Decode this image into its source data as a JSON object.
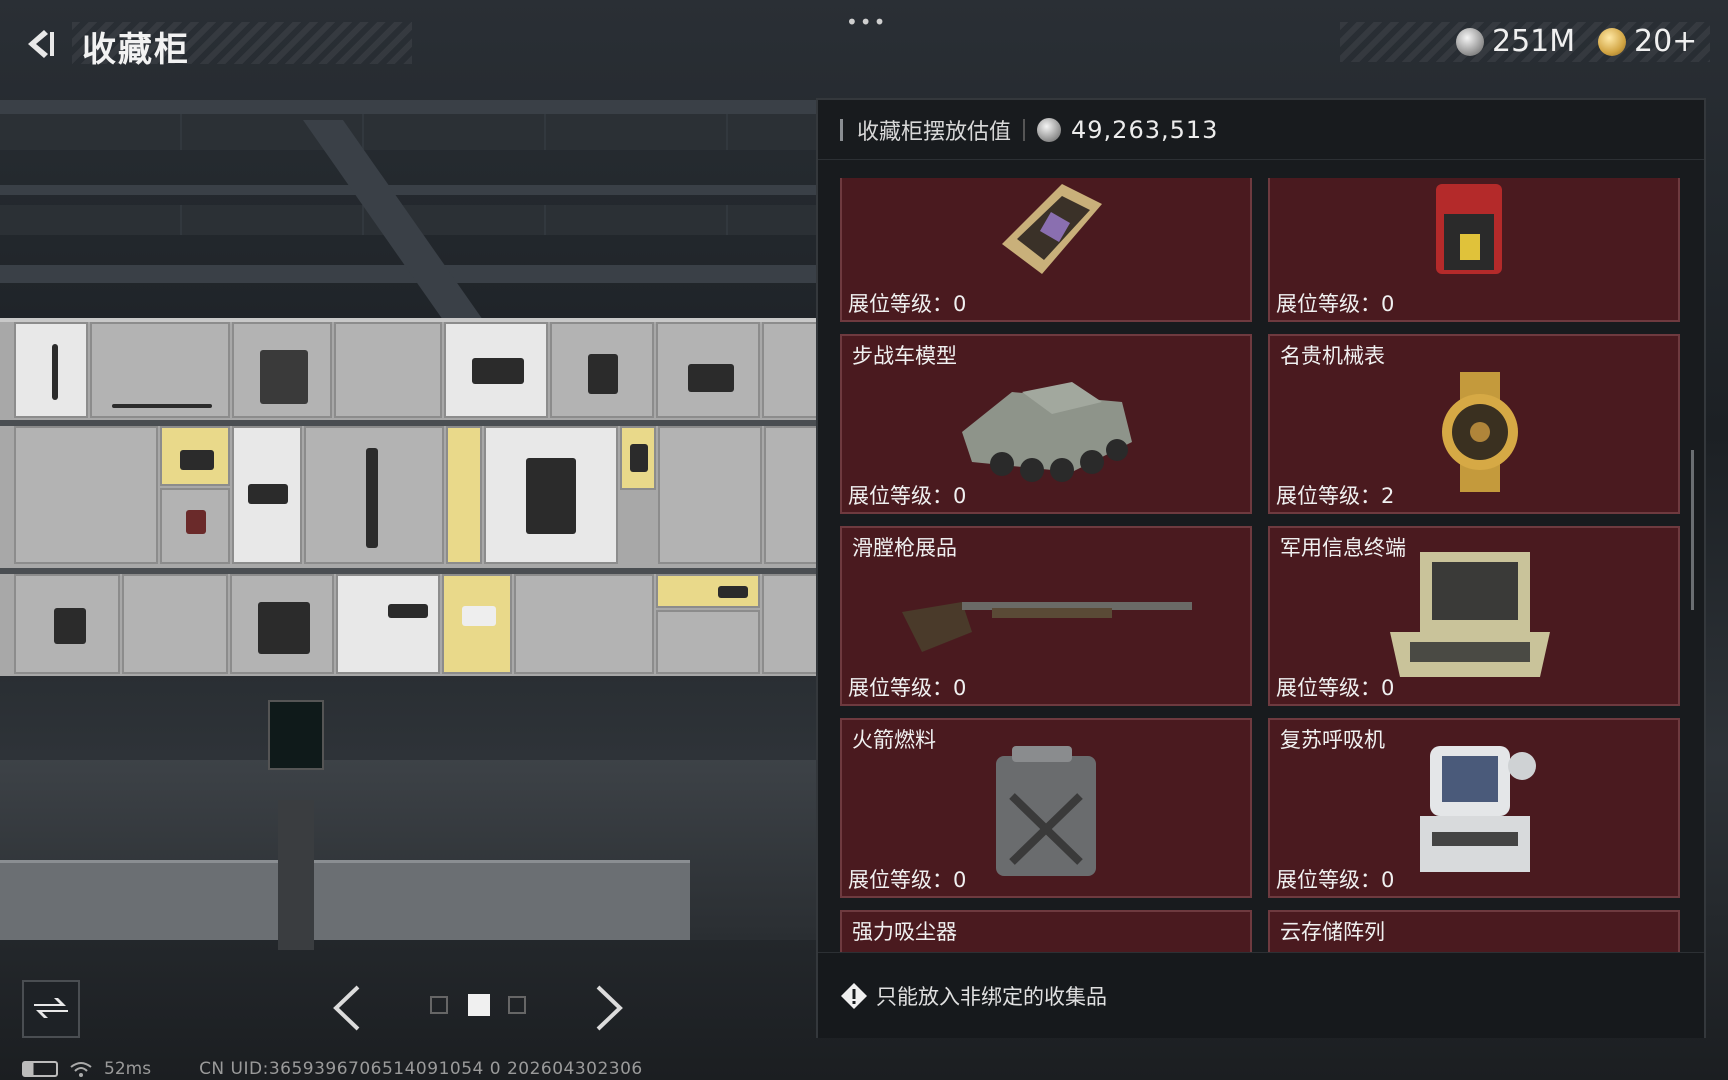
{
  "topbar": {
    "title": "收藏柜",
    "more": "•••",
    "currency_silver": "251M",
    "currency_gold": "20+"
  },
  "panel": {
    "header_label": "收藏柜摆放估值",
    "header_value": "49,263,513",
    "cards": [
      {
        "name": "",
        "level_label": "展位等级：",
        "level": "0",
        "art": "ram-chip-icon"
      },
      {
        "name": "",
        "level_label": "展位等级：",
        "level": "0",
        "art": "red-device-icon"
      },
      {
        "name": "步战车模型",
        "level_label": "展位等级：",
        "level": "0",
        "art": "ifv-model-icon"
      },
      {
        "name": "名贵机械表",
        "level_label": "展位等级：",
        "level": "2",
        "art": "gold-watch-icon"
      },
      {
        "name": "滑膛枪展品",
        "level_label": "展位等级：",
        "level": "0",
        "art": "musket-icon"
      },
      {
        "name": "军用信息终端",
        "level_label": "展位等级：",
        "level": "0",
        "art": "military-terminal-icon"
      },
      {
        "name": "火箭燃料",
        "level_label": "展位等级：",
        "level": "0",
        "art": "fuel-canister-icon"
      },
      {
        "name": "复苏呼吸机",
        "level_label": "展位等级：",
        "level": "0",
        "art": "ventilator-icon"
      },
      {
        "name": "强力吸尘器",
        "level_label": "",
        "level": "",
        "art": ""
      },
      {
        "name": "云存储阵列",
        "level_label": "",
        "level": "",
        "art": ""
      }
    ],
    "footer_text": "只能放入非绑定的收集品"
  },
  "pager": {
    "active_page": 2,
    "total_pages": 3
  },
  "status": {
    "ping": "52ms",
    "uid": "CN UID:3659396706514091054 0 202604302306"
  },
  "colors": {
    "card_bg": "#4a1a1f",
    "panel_bg": "#181b1e",
    "coin_gold": "#d2a544"
  }
}
